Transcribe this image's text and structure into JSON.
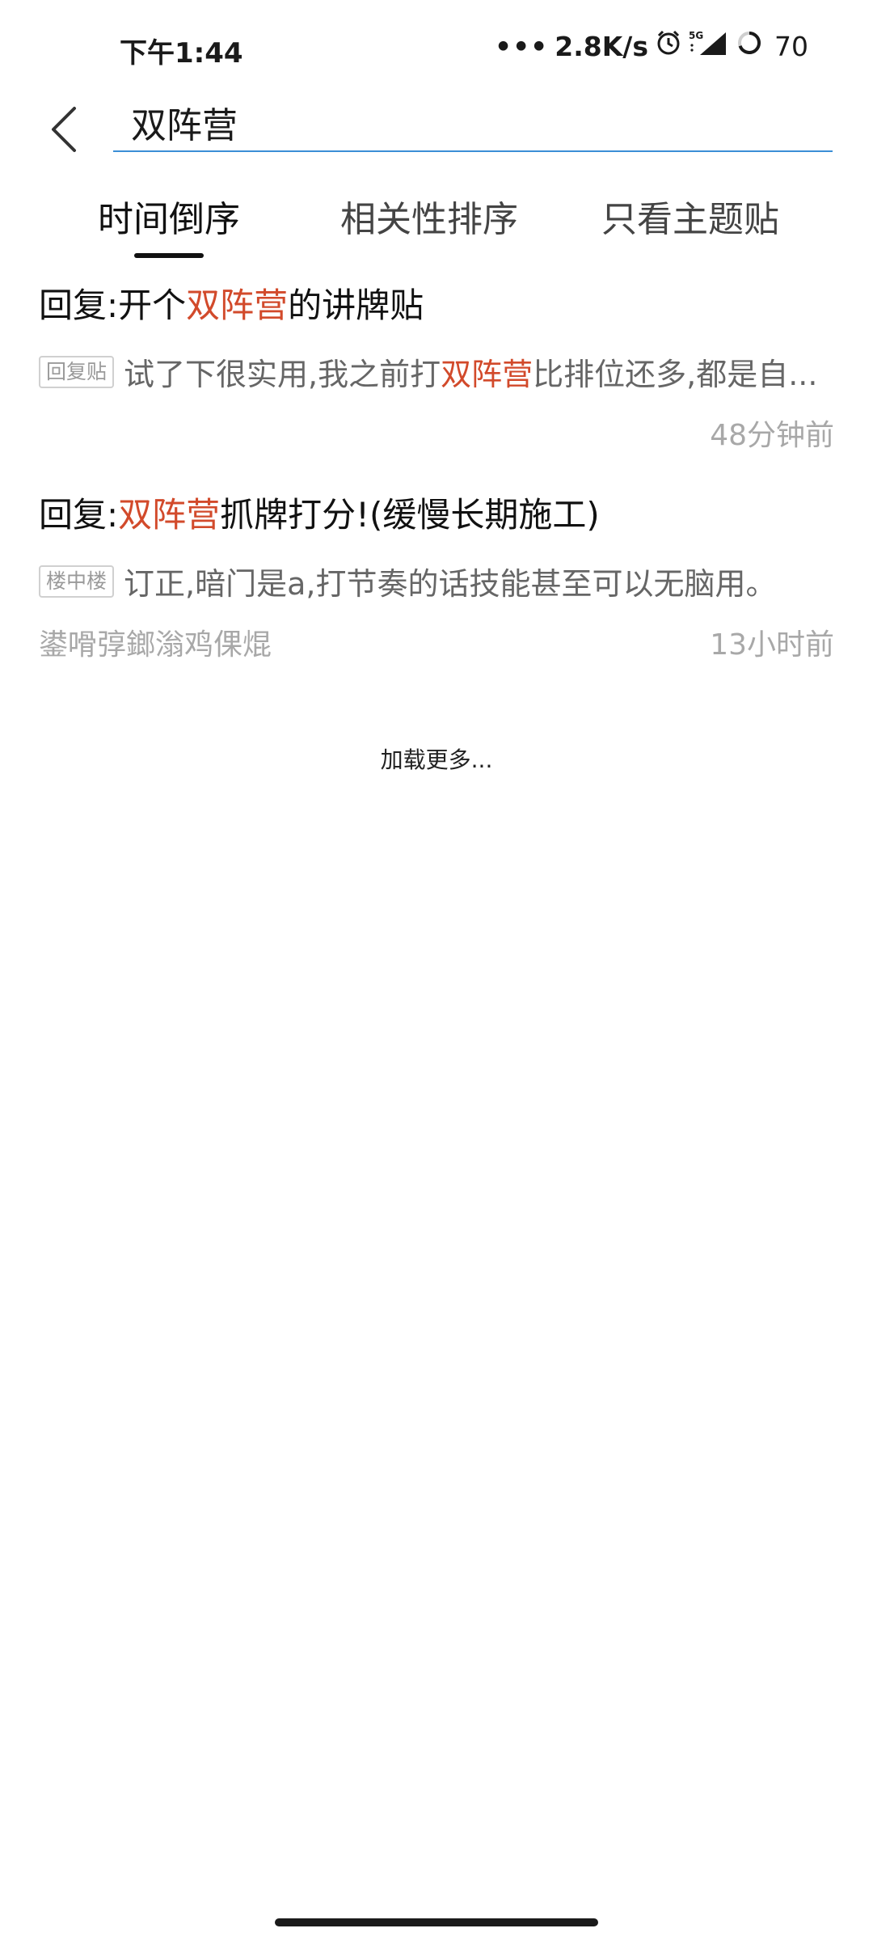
{
  "status_bar": {
    "time": "下午1:44",
    "network_speed": "2.8K/s",
    "signal_label": "5G",
    "battery": "70"
  },
  "search": {
    "query": "双阵营"
  },
  "tabs": [
    {
      "label": "时间倒序",
      "active": true
    },
    {
      "label": "相关性排序",
      "active": false
    },
    {
      "label": "只看主题贴",
      "active": false
    }
  ],
  "results": [
    {
      "title_prefix": "回复:开个",
      "title_highlight": "双阵营",
      "title_suffix": "的讲牌贴",
      "tag": "回复贴",
      "snippet_prefix": "试了下很实用,我之前打",
      "snippet_highlight": "双阵营",
      "snippet_suffix": "比排位还多,都是自...",
      "author": "",
      "time": "48分钟前"
    },
    {
      "title_prefix": "回复:",
      "title_highlight": "双阵营",
      "title_suffix": "抓牌打分!(缓慢长期施工)",
      "tag": "楼中楼",
      "snippet_prefix": "订正,暗门是a,打节奏的话技能甚至可以无脑用。",
      "snippet_highlight": "",
      "snippet_suffix": "",
      "author": "鍙嗗弴鎯滃鸡倮焜",
      "time": "13小时前"
    }
  ],
  "load_more": "加载更多...",
  "colors": {
    "highlight": "#d24a2b",
    "search_underline": "#3b8ed6"
  }
}
